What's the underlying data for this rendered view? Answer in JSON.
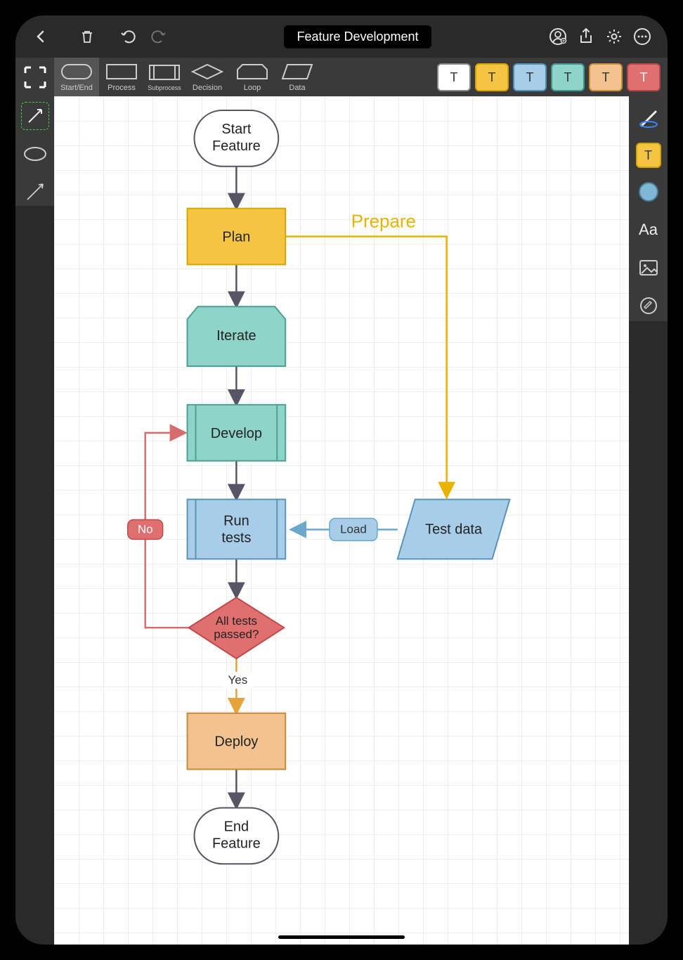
{
  "title": "Feature Development",
  "toolbar_shapes": [
    {
      "name": "select",
      "label": "",
      "selected": false
    },
    {
      "name": "startend",
      "label": "Start/End",
      "selected": true
    },
    {
      "name": "process",
      "label": "Process",
      "selected": false
    },
    {
      "name": "subprocess",
      "label": "Subprocess",
      "selected": false
    },
    {
      "name": "decision",
      "label": "Decision",
      "selected": false
    },
    {
      "name": "loop",
      "label": "Loop",
      "selected": false
    },
    {
      "name": "data",
      "label": "Data",
      "selected": false
    }
  ],
  "swatches": [
    {
      "bg": "#ffffff",
      "border": "#888",
      "text": "T",
      "tc": "#333"
    },
    {
      "bg": "#f5c542",
      "border": "#d9a400",
      "text": "T",
      "tc": "#333"
    },
    {
      "bg": "#a7cde8",
      "border": "#4a90b8",
      "text": "T",
      "tc": "#333"
    },
    {
      "bg": "#8fd4c8",
      "border": "#3a9688",
      "text": "T",
      "tc": "#333"
    },
    {
      "bg": "#f2c28f",
      "border": "#c98a3a",
      "text": "T",
      "tc": "#333"
    },
    {
      "bg": "#e07070",
      "border": "#b84545",
      "text": "T",
      "tc": "#fff"
    }
  ],
  "right_swatch": {
    "bg": "#f5c542",
    "text": "T"
  },
  "nodes": {
    "start": {
      "line1": "Start",
      "line2": "Feature"
    },
    "plan": {
      "label": "Plan"
    },
    "iterate": {
      "label": "Iterate"
    },
    "develop": {
      "label": "Develop"
    },
    "runtests": {
      "line1": "Run",
      "line2": "tests"
    },
    "decision": {
      "line1": "All tests",
      "line2": "passed?"
    },
    "deploy": {
      "label": "Deploy"
    },
    "end": {
      "line1": "End",
      "line2": "Feature"
    },
    "testdata": {
      "label": "Test data"
    }
  },
  "edge_labels": {
    "prepare": "Prepare",
    "load": "Load",
    "no": "No",
    "yes": "Yes"
  },
  "chart_data": {
    "type": "flowchart",
    "title": "Feature Development",
    "nodes": [
      {
        "id": "start",
        "type": "start-end",
        "label": "Start Feature",
        "color": "white"
      },
      {
        "id": "plan",
        "type": "process",
        "label": "Plan",
        "color": "yellow"
      },
      {
        "id": "iterate",
        "type": "loop",
        "label": "Iterate",
        "color": "teal"
      },
      {
        "id": "develop",
        "type": "subprocess",
        "label": "Develop",
        "color": "teal"
      },
      {
        "id": "runtests",
        "type": "subprocess",
        "label": "Run tests",
        "color": "blue"
      },
      {
        "id": "testdata",
        "type": "data",
        "label": "Test data",
        "color": "blue"
      },
      {
        "id": "decision",
        "type": "decision",
        "label": "All tests passed?",
        "color": "red"
      },
      {
        "id": "deploy",
        "type": "process",
        "label": "Deploy",
        "color": "orange"
      },
      {
        "id": "end",
        "type": "start-end",
        "label": "End Feature",
        "color": "white"
      }
    ],
    "edges": [
      {
        "from": "start",
        "to": "plan"
      },
      {
        "from": "plan",
        "to": "iterate"
      },
      {
        "from": "plan",
        "to": "testdata",
        "label": "Prepare"
      },
      {
        "from": "iterate",
        "to": "develop"
      },
      {
        "from": "develop",
        "to": "runtests"
      },
      {
        "from": "testdata",
        "to": "runtests",
        "label": "Load"
      },
      {
        "from": "runtests",
        "to": "decision"
      },
      {
        "from": "decision",
        "to": "develop",
        "label": "No"
      },
      {
        "from": "decision",
        "to": "deploy",
        "label": "Yes"
      },
      {
        "from": "deploy",
        "to": "end"
      }
    ]
  }
}
